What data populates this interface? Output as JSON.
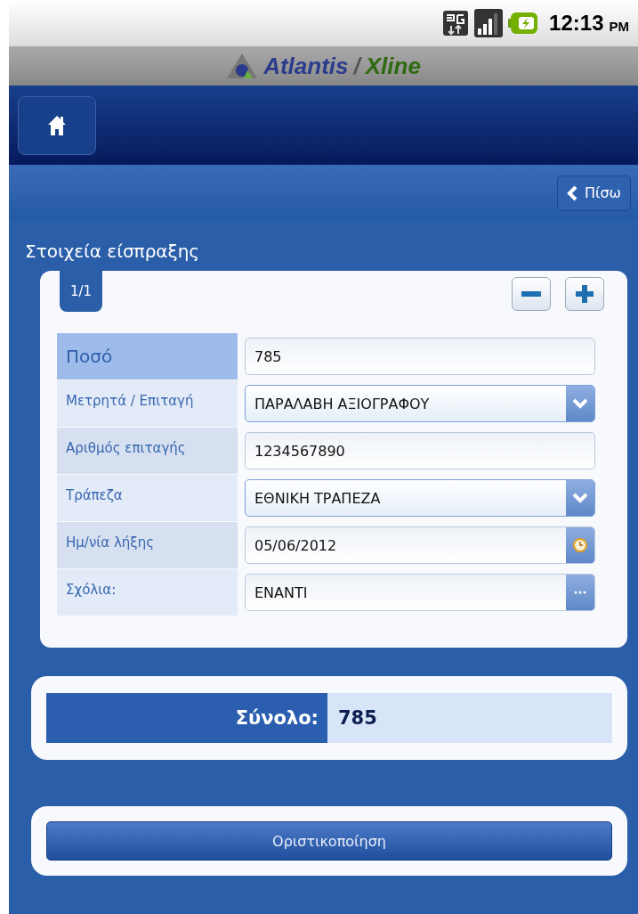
{
  "status_bar": {
    "time": "12:13",
    "meridiem": "PM"
  },
  "logo": {
    "name_1": "Atlantis",
    "separator": "/",
    "name_2": "Xline"
  },
  "nav": {
    "back_button": "Πίσω"
  },
  "section_title": "Στοιχεία είσπραξης",
  "card": {
    "page_tab": "1/1",
    "rows": [
      {
        "label": "Ποσό",
        "kind": "text",
        "value": "785",
        "selected": true
      },
      {
        "label": "Μετρητά / Επιταγή",
        "kind": "select",
        "value": "ΠΑΡΑΛΑΒΗ ΑΞΙΟΓΡΑΦΟΥ",
        "selected": false
      },
      {
        "label": "Αριθμός επιταγής",
        "kind": "text",
        "value": "1234567890",
        "selected": false
      },
      {
        "label": "Τράπεζα",
        "kind": "select",
        "value": "ΕΘΝΙΚΗ ΤΡΑΠΕΖΑ",
        "selected": false
      },
      {
        "label": "Ημ/νία λήξης",
        "kind": "date",
        "value": "05/06/2012",
        "selected": false
      },
      {
        "label": "Σχόλια:",
        "kind": "more",
        "value": "ΕΝΑΝΤΙ",
        "selected": false
      }
    ]
  },
  "total": {
    "label": "Σύνολο:",
    "value": "785"
  },
  "confirm_button": "Οριστικοποίηση"
}
